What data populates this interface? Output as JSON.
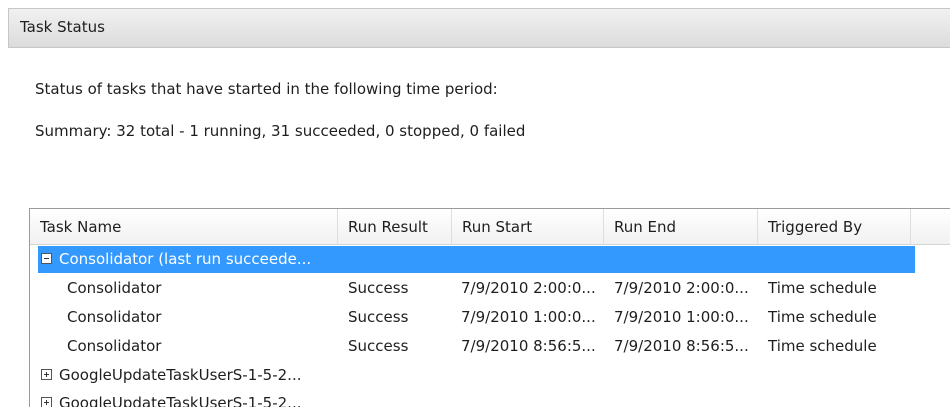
{
  "panel": {
    "title": "Task Status",
    "description": "Status of tasks that have started in the following time period:",
    "summary": "Summary: 32 total - 1 running, 31 succeeded, 0 stopped, 0 failed"
  },
  "table": {
    "columns": [
      "Task Name",
      "Run Result",
      "Run Start",
      "Run End",
      "Triggered By"
    ],
    "groups": [
      {
        "label": "Consolidator (last run succeede...",
        "expanded": true,
        "rows": [
          {
            "name": "Consolidator",
            "result": "Success",
            "start": "7/9/2010 2:00:0...",
            "end": "7/9/2010 2:00:0...",
            "trigger": "Time schedule"
          },
          {
            "name": "Consolidator",
            "result": "Success",
            "start": "7/9/2010 1:00:0...",
            "end": "7/9/2010 1:00:0...",
            "trigger": "Time schedule"
          },
          {
            "name": "Consolidator",
            "result": "Success",
            "start": "7/9/2010 8:56:5...",
            "end": "7/9/2010 8:56:5...",
            "trigger": "Time schedule"
          }
        ]
      },
      {
        "label": "GoogleUpdateTaskUserS-1-5-2...",
        "expanded": false
      },
      {
        "label": "GoogleUpdateTaskUserS-1-5-2...",
        "expanded": false
      }
    ]
  },
  "colors": {
    "selection": "#3399ff",
    "header_gradient_top": "#f1f1f1",
    "header_gradient_bottom": "#dcdcdc"
  },
  "icons": {
    "collapse": "collapse-icon",
    "expand": "expand-icon"
  }
}
